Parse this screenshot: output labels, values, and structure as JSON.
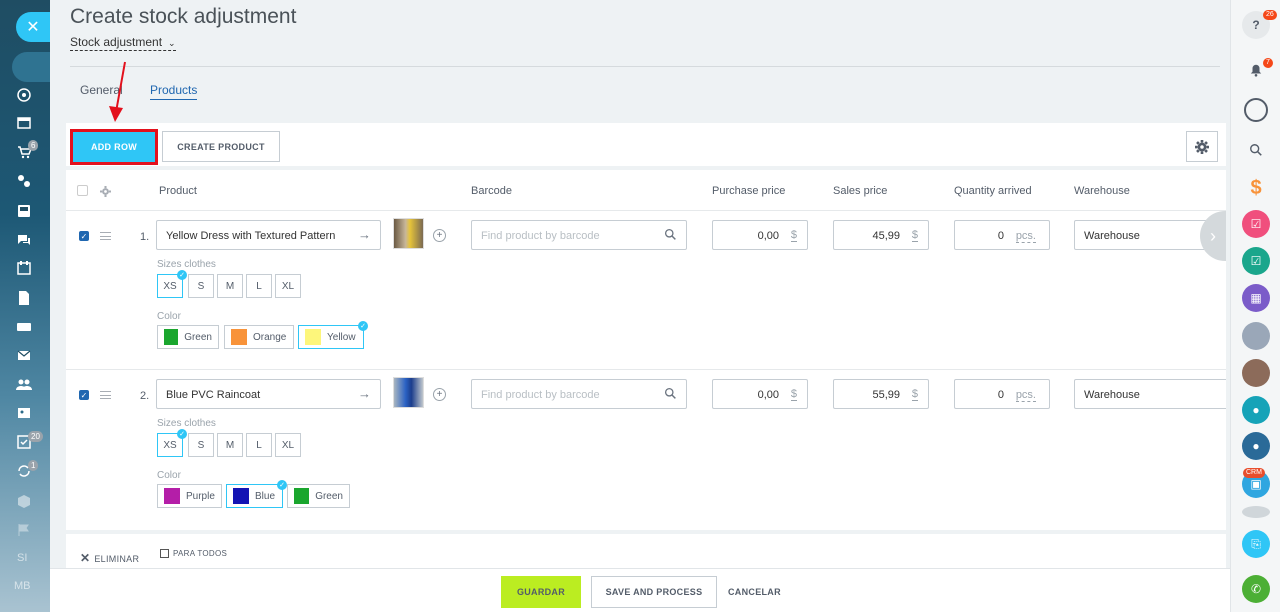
{
  "page": {
    "title": "Create stock adjustment",
    "subtitle": "Stock adjustment",
    "tabs": [
      {
        "label": "General"
      },
      {
        "label": "Products"
      }
    ]
  },
  "toolbar": {
    "add_row": "ADD ROW",
    "create_product": "CREATE PRODUCT"
  },
  "columns": [
    "Product",
    "Barcode",
    "Purchase price",
    "Sales price",
    "Quantity arrived",
    "Warehouse"
  ],
  "left_sidebar": {
    "badges": {
      "cart": "6",
      "tasks": "20",
      "sync": "1"
    },
    "bottom_labels": [
      "SI",
      "MB"
    ]
  },
  "right_sidebar": {
    "badges": {
      "help": "26",
      "notifications": "7"
    },
    "crm_label": "CRM"
  },
  "rows": [
    {
      "number": "1.",
      "product": "Yellow Dress with Textured Pattern",
      "barcode_placeholder": "Find product by barcode",
      "purchase_price": "0,00",
      "sales_price": "45,99",
      "currency": "$",
      "quantity": "0",
      "unit": "pcs.",
      "warehouse": "Warehouse",
      "sizes_label": "Sizes clothes",
      "sizes": [
        "XS",
        "S",
        "M",
        "L",
        "XL"
      ],
      "selected_size": "XS",
      "color_label": "Color",
      "colors": [
        {
          "name": "Green",
          "hex": "#1aa62e",
          "selected": false
        },
        {
          "name": "Orange",
          "hex": "#f8933a",
          "selected": false
        },
        {
          "name": "Yellow",
          "hex": "#fdf67b",
          "selected": true
        }
      ]
    },
    {
      "number": "2.",
      "product": "Blue PVC Raincoat",
      "barcode_placeholder": "Find product by barcode",
      "purchase_price": "0,00",
      "sales_price": "55,99",
      "currency": "$",
      "quantity": "0",
      "unit": "pcs.",
      "warehouse": "Warehouse",
      "sizes_label": "Sizes clothes",
      "sizes": [
        "XS",
        "S",
        "M",
        "L",
        "XL"
      ],
      "selected_size": "XS",
      "color_label": "Color",
      "colors": [
        {
          "name": "Purple",
          "hex": "#b41ea8",
          "selected": false
        },
        {
          "name": "Blue",
          "hex": "#1414b4",
          "selected": true
        },
        {
          "name": "Green",
          "hex": "#1aa62e",
          "selected": false
        }
      ]
    }
  ],
  "bottom": {
    "delete": "ELIMINAR",
    "for_all": "PARA TODOS"
  },
  "footer": {
    "save": "GUARDAR",
    "save_process": "SAVE AND PROCESS",
    "cancel": "CANCELAR"
  },
  "colors": {
    "accent": "#2fc6f6",
    "save": "#bbed21",
    "highlight": "#e3101c",
    "link": "#2067b0"
  }
}
